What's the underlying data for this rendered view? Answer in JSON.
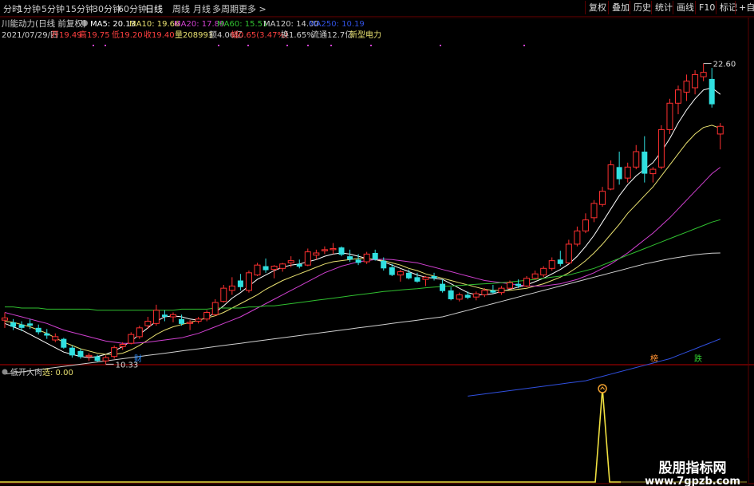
{
  "toolbar": {
    "timeframes": [
      "分时",
      "1分钟",
      "5分钟",
      "15分钟",
      "30分钟",
      "60分钟",
      "日线",
      "周线",
      "月线",
      "多周期",
      "更多 >"
    ],
    "active_index": 6,
    "right_buttons": [
      "复权",
      "叠加",
      "历史",
      "统计",
      "画线",
      "F10",
      "标记",
      "+自选"
    ]
  },
  "main_panel": {
    "title": "川能动力(日线 前复权)",
    "ma_values": [
      {
        "label": "MA5: 20.13",
        "color": "#ffffff"
      },
      {
        "label": "MA10: 19.66",
        "color": "#e8e070"
      },
      {
        "label": "MA20: 17.89",
        "color": "#d040d0"
      },
      {
        "label": "MA60: 15.51",
        "color": "#30c030"
      },
      {
        "label": "MA120: 14.00",
        "color": "#cfcfcf"
      },
      {
        "label": "MA250: 10.19",
        "color": "#3050e0"
      }
    ],
    "info_line": [
      {
        "text": "2021/07/29/四",
        "color": "#cfcfcf"
      },
      {
        "text": "开19.49",
        "color": "#ff4040"
      },
      {
        "text": "高19.75",
        "color": "#ff4040"
      },
      {
        "text": "低19.20",
        "color": "#ff4040"
      },
      {
        "text": "收19.40",
        "color": "#ff4040"
      },
      {
        "text": "量208993",
        "color": "#e8e070"
      },
      {
        "text": "额4.06亿",
        "color": "#cfcfcf"
      },
      {
        "text": "幅0.65(3.47%)",
        "color": "#ff4040"
      },
      {
        "text": "换1.65%",
        "color": "#cfcfcf"
      },
      {
        "text": "流通12.7亿",
        "color": "#cfcfcf"
      },
      {
        "text": "新型电力",
        "color": "#e8e070"
      }
    ],
    "high_label": "22.60",
    "low_label": "10.33",
    "markers": [
      {
        "text": "财",
        "color": "#3090ff"
      },
      {
        "text": "榜",
        "color": "#ff9030"
      },
      {
        "text": "跌",
        "color": "#30d030"
      }
    ]
  },
  "indicator_panel": {
    "title": "低开大肉",
    "value_label": "选: 0.00",
    "signal_value": 1
  },
  "watermark": {
    "line1": "股朋指标网",
    "line2": "www.7gpzb.com"
  },
  "chart_data": {
    "type": "candlestick",
    "price_range": [
      9.0,
      23.6
    ],
    "dates_last": "2021/07/29",
    "candles": [
      [
        10.95,
        11.3,
        10.6,
        11.05
      ],
      [
        10.85,
        11.0,
        10.5,
        10.65
      ],
      [
        10.75,
        10.9,
        10.45,
        10.6
      ],
      [
        10.8,
        11.0,
        10.55,
        10.7
      ],
      [
        10.6,
        10.75,
        10.3,
        10.4
      ],
      [
        10.35,
        10.55,
        10.1,
        10.25
      ],
      [
        10.05,
        10.35,
        9.95,
        10.2
      ],
      [
        10.1,
        10.15,
        9.65,
        9.7
      ],
      [
        9.7,
        9.8,
        9.25,
        9.35
      ],
      [
        9.55,
        9.65,
        9.2,
        9.28
      ],
      [
        9.3,
        9.45,
        9.1,
        9.35
      ],
      [
        9.3,
        9.38,
        9.05,
        9.1
      ],
      [
        9.1,
        9.35,
        8.95,
        9.25
      ],
      [
        9.3,
        9.8,
        9.2,
        9.7
      ],
      [
        9.75,
        9.95,
        9.6,
        9.85
      ],
      [
        9.9,
        10.4,
        9.85,
        10.3
      ],
      [
        10.2,
        10.7,
        10.1,
        10.6
      ],
      [
        10.7,
        11.1,
        10.55,
        10.9
      ],
      [
        10.8,
        11.65,
        10.7,
        11.4
      ],
      [
        11.2,
        11.4,
        10.9,
        11.1
      ],
      [
        11.1,
        11.3,
        10.85,
        11.2
      ],
      [
        11.0,
        11.2,
        10.7,
        10.78
      ],
      [
        10.8,
        10.95,
        10.5,
        10.85
      ],
      [
        10.9,
        11.1,
        10.8,
        11.0
      ],
      [
        11.0,
        11.4,
        10.9,
        11.3
      ],
      [
        11.2,
        11.9,
        11.15,
        11.75
      ],
      [
        11.8,
        12.55,
        11.75,
        12.4
      ],
      [
        12.3,
        12.9,
        12.1,
        12.5
      ],
      [
        12.75,
        13.05,
        12.3,
        12.45
      ],
      [
        12.3,
        13.2,
        12.2,
        13.1
      ],
      [
        13.0,
        13.55,
        12.95,
        13.45
      ],
      [
        13.4,
        13.75,
        13.1,
        13.22
      ],
      [
        13.25,
        13.45,
        12.85,
        13.4
      ],
      [
        13.3,
        13.55,
        13.15,
        13.5
      ],
      [
        13.55,
        13.85,
        13.35,
        13.65
      ],
      [
        13.5,
        13.7,
        13.3,
        13.38
      ],
      [
        13.45,
        14.2,
        13.4,
        14.05
      ],
      [
        13.9,
        14.15,
        13.7,
        14.0
      ],
      [
        14.1,
        14.3,
        13.95,
        14.15
      ],
      [
        14.15,
        14.45,
        13.95,
        14.2
      ],
      [
        14.25,
        14.3,
        13.85,
        13.92
      ],
      [
        13.85,
        14.15,
        13.6,
        13.7
      ],
      [
        13.7,
        13.95,
        13.45,
        13.55
      ],
      [
        13.6,
        14.05,
        13.5,
        13.95
      ],
      [
        14.0,
        14.15,
        13.65,
        13.7
      ],
      [
        13.65,
        13.8,
        13.2,
        13.3
      ],
      [
        13.35,
        13.5,
        12.95,
        13.0
      ],
      [
        13.0,
        13.25,
        12.7,
        13.15
      ],
      [
        13.1,
        13.25,
        12.8,
        12.85
      ],
      [
        12.9,
        13.1,
        12.65,
        12.7
      ],
      [
        12.8,
        12.95,
        12.5,
        12.9
      ],
      [
        12.95,
        13.1,
        12.75,
        12.85
      ],
      [
        12.6,
        12.8,
        12.2,
        12.27
      ],
      [
        12.3,
        12.45,
        11.85,
        11.9
      ],
      [
        11.9,
        12.2,
        11.8,
        12.1
      ],
      [
        12.1,
        12.25,
        11.9,
        11.97
      ],
      [
        12.0,
        12.25,
        11.85,
        12.15
      ],
      [
        12.1,
        12.4,
        12.0,
        12.3
      ],
      [
        12.3,
        12.55,
        12.15,
        12.2
      ],
      [
        12.2,
        12.5,
        12.1,
        12.4
      ],
      [
        12.4,
        12.75,
        12.35,
        12.65
      ],
      [
        12.6,
        12.8,
        12.4,
        12.5
      ],
      [
        12.5,
        12.95,
        12.45,
        12.85
      ],
      [
        12.85,
        13.2,
        12.8,
        13.05
      ],
      [
        13.0,
        13.4,
        12.9,
        13.3
      ],
      [
        13.3,
        13.8,
        13.2,
        13.65
      ],
      [
        13.7,
        14.1,
        13.4,
        13.5
      ],
      [
        13.55,
        14.6,
        13.5,
        14.4
      ],
      [
        14.4,
        15.2,
        14.3,
        15.0
      ],
      [
        15.0,
        15.8,
        14.9,
        15.5
      ],
      [
        15.6,
        16.4,
        15.4,
        16.25
      ],
      [
        16.2,
        17.0,
        16.1,
        16.8
      ],
      [
        16.9,
        18.2,
        16.85,
        18.0
      ],
      [
        17.9,
        18.6,
        17.1,
        17.35
      ],
      [
        17.4,
        18.1,
        17.2,
        17.9
      ],
      [
        17.9,
        18.9,
        17.8,
        18.6
      ],
      [
        18.6,
        19.3,
        17.2,
        17.6
      ],
      [
        17.6,
        17.9,
        17.2,
        17.8
      ],
      [
        17.9,
        19.8,
        17.8,
        19.6
      ],
      [
        19.6,
        21.0,
        19.4,
        20.8
      ],
      [
        20.8,
        21.6,
        20.3,
        21.4
      ],
      [
        21.3,
        22.1,
        20.9,
        21.8
      ],
      [
        21.5,
        22.3,
        21.2,
        22.1
      ],
      [
        22.0,
        22.6,
        21.8,
        22.2
      ],
      [
        21.9,
        22.4,
        20.6,
        20.75
      ],
      [
        19.4,
        19.9,
        18.7,
        19.75
      ]
    ],
    "ma_lines": {
      "MA5": [
        10.8,
        10.65,
        10.5,
        10.3,
        10.1,
        9.9,
        9.7,
        9.5,
        9.4,
        9.3,
        9.25,
        9.3,
        9.4,
        9.55,
        9.75,
        10.0,
        10.3,
        10.6,
        10.9,
        11.1,
        11.15,
        11.1,
        11.0,
        10.95,
        11.05,
        11.3,
        11.6,
        11.95,
        12.2,
        12.5,
        12.8,
        13.0,
        13.2,
        13.35,
        13.45,
        13.5,
        13.6,
        13.7,
        13.85,
        13.95,
        14.0,
        13.95,
        13.85,
        13.75,
        13.7,
        13.6,
        13.45,
        13.3,
        13.15,
        13.0,
        12.9,
        12.85,
        12.8,
        12.6,
        12.4,
        12.2,
        12.1,
        12.1,
        12.15,
        12.25,
        12.35,
        12.45,
        12.55,
        12.7,
        12.85,
        13.05,
        13.25,
        13.5,
        13.85,
        14.3,
        14.8,
        15.4,
        16.0,
        16.6,
        17.1,
        17.5,
        17.8,
        18.1,
        18.6,
        19.2,
        19.9,
        20.5,
        21.0,
        21.4,
        21.5,
        21.2
      ],
      "MA10": [
        10.9,
        10.85,
        10.75,
        10.65,
        10.5,
        10.35,
        10.15,
        9.95,
        9.8,
        9.65,
        9.55,
        9.45,
        9.4,
        9.4,
        9.45,
        9.6,
        9.8,
        10.05,
        10.3,
        10.5,
        10.65,
        10.75,
        10.85,
        10.95,
        11.05,
        11.15,
        11.3,
        11.5,
        11.7,
        11.9,
        12.1,
        12.35,
        12.55,
        12.75,
        12.9,
        13.05,
        13.2,
        13.35,
        13.5,
        13.6,
        13.65,
        13.7,
        13.75,
        13.75,
        13.7,
        13.65,
        13.55,
        13.45,
        13.3,
        13.2,
        13.05,
        12.95,
        12.85,
        12.75,
        12.65,
        12.55,
        12.45,
        12.35,
        12.3,
        12.3,
        12.3,
        12.35,
        12.4,
        12.5,
        12.6,
        12.75,
        12.9,
        13.1,
        13.35,
        13.65,
        14.0,
        14.4,
        14.85,
        15.3,
        15.8,
        16.2,
        16.6,
        17.0,
        17.5,
        18.0,
        18.5,
        19.0,
        19.4,
        19.7,
        19.8,
        19.66
      ],
      "MA20": [
        11.3,
        11.2,
        11.1,
        11.0,
        10.9,
        10.8,
        10.65,
        10.5,
        10.4,
        10.3,
        10.2,
        10.1,
        10.0,
        9.95,
        9.9,
        9.9,
        9.92,
        9.95,
        10.0,
        10.05,
        10.1,
        10.15,
        10.25,
        10.35,
        10.5,
        10.65,
        10.8,
        10.95,
        11.1,
        11.3,
        11.5,
        11.7,
        11.9,
        12.1,
        12.3,
        12.5,
        12.7,
        12.9,
        13.1,
        13.25,
        13.4,
        13.5,
        13.6,
        13.65,
        13.7,
        13.72,
        13.7,
        13.65,
        13.6,
        13.55,
        13.45,
        13.35,
        13.25,
        13.15,
        13.05,
        12.95,
        12.85,
        12.75,
        12.7,
        12.65,
        12.6,
        12.55,
        12.5,
        12.5,
        12.5,
        12.55,
        12.6,
        12.7,
        12.8,
        12.95,
        13.1,
        13.3,
        13.5,
        13.75,
        14.0,
        14.3,
        14.6,
        14.9,
        15.25,
        15.6,
        16.0,
        16.4,
        16.8,
        17.2,
        17.6,
        17.89
      ],
      "MA60": [
        11.55,
        11.55,
        11.5,
        11.5,
        11.5,
        11.45,
        11.45,
        11.45,
        11.45,
        11.45,
        11.45,
        11.4,
        11.4,
        11.4,
        11.4,
        11.4,
        11.4,
        11.4,
        11.4,
        11.4,
        11.4,
        11.45,
        11.45,
        11.45,
        11.45,
        11.5,
        11.5,
        11.5,
        11.5,
        11.55,
        11.55,
        11.6,
        11.6,
        11.65,
        11.7,
        11.75,
        11.8,
        11.85,
        11.9,
        11.95,
        12.0,
        12.05,
        12.1,
        12.15,
        12.2,
        12.25,
        12.28,
        12.32,
        12.35,
        12.38,
        12.42,
        12.45,
        12.48,
        12.5,
        12.52,
        12.55,
        12.58,
        12.6,
        12.62,
        12.65,
        12.68,
        12.72,
        12.76,
        12.8,
        12.85,
        12.9,
        12.95,
        13.0,
        13.1,
        13.2,
        13.3,
        13.45,
        13.6,
        13.75,
        13.9,
        14.05,
        14.2,
        14.35,
        14.5,
        14.65,
        14.8,
        14.95,
        15.1,
        15.25,
        15.4,
        15.51
      ],
      "MA120": [
        8.5,
        8.55,
        8.6,
        8.65,
        8.7,
        8.75,
        8.8,
        8.85,
        8.9,
        8.95,
        9.0,
        9.05,
        9.1,
        9.15,
        9.2,
        9.25,
        9.3,
        9.35,
        9.4,
        9.45,
        9.5,
        9.55,
        9.6,
        9.65,
        9.7,
        9.75,
        9.8,
        9.85,
        9.9,
        9.95,
        10.0,
        10.05,
        10.1,
        10.15,
        10.2,
        10.25,
        10.3,
        10.35,
        10.4,
        10.45,
        10.5,
        10.55,
        10.6,
        10.65,
        10.7,
        10.75,
        10.8,
        10.85,
        10.9,
        10.95,
        11.0,
        11.05,
        11.1,
        11.2,
        11.3,
        11.4,
        11.5,
        11.6,
        11.7,
        11.8,
        11.9,
        12.0,
        12.1,
        12.2,
        12.3,
        12.4,
        12.5,
        12.6,
        12.7,
        12.8,
        12.9,
        13.0,
        13.1,
        13.2,
        13.3,
        13.4,
        13.5,
        13.58,
        13.66,
        13.74,
        13.8,
        13.86,
        13.92,
        13.96,
        13.99,
        14.0
      ],
      "MA250_start_index": 55,
      "MA250": [
        7.5,
        7.55,
        7.6,
        7.65,
        7.7,
        7.75,
        7.8,
        7.85,
        7.9,
        7.95,
        8.0,
        8.05,
        8.1,
        8.15,
        8.2,
        8.3,
        8.4,
        8.5,
        8.6,
        8.7,
        8.8,
        8.9,
        9.0,
        9.1,
        9.2,
        9.35,
        9.5,
        9.65,
        9.8,
        9.95,
        10.1
      ]
    },
    "indicator_signal_index": 71
  }
}
